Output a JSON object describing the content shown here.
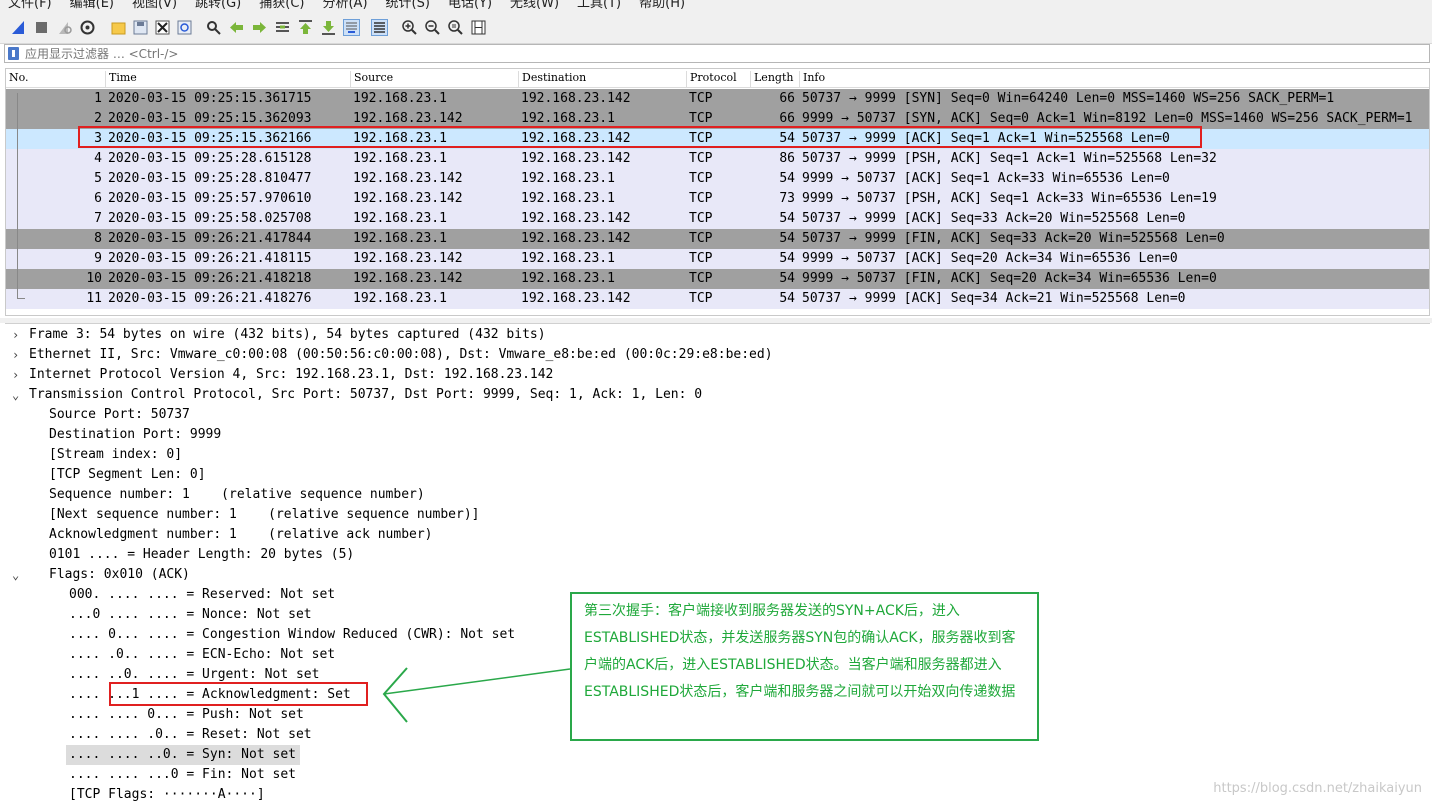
{
  "menu": {
    "items": [
      "文件(F)",
      "编辑(E)",
      "视图(V)",
      "跳转(G)",
      "捕获(C)",
      "分析(A)",
      "统计(S)",
      "电话(Y)",
      "无线(W)",
      "工具(T)",
      "帮助(H)"
    ]
  },
  "toolbar": {
    "icons": [
      "shark-fin-start-icon",
      "stop-icon",
      "restart-icon",
      "options-gear-icon",
      "open-folder-icon",
      "save-icon",
      "close-file-icon",
      "reload-icon",
      "find-icon",
      "back-arrow-icon",
      "forward-arrow-icon",
      "goto-packet-icon",
      "first-packet-icon",
      "last-packet-icon",
      "autoscroll-icon",
      "colorize-icon",
      "zoom-in-icon",
      "zoom-out-icon",
      "zoom-reset-icon",
      "resize-columns-icon"
    ]
  },
  "filter": {
    "placeholder": "应用显示过滤器 … <Ctrl-/>"
  },
  "columns": {
    "no": "No.",
    "time": "Time",
    "source": "Source",
    "destination": "Destination",
    "protocol": "Protocol",
    "length": "Length",
    "info": "Info"
  },
  "packets": [
    {
      "no": "1",
      "time": "2020-03-15 09:25:15.361715",
      "src": "192.168.23.1",
      "dst": "192.168.23.142",
      "proto": "TCP",
      "len": "66",
      "info": "50737 → 9999 [SYN] Seq=0 Win=64240 Len=0 MSS=1460 WS=256 SACK_PERM=1"
    },
    {
      "no": "2",
      "time": "2020-03-15 09:25:15.362093",
      "src": "192.168.23.142",
      "dst": "192.168.23.1",
      "proto": "TCP",
      "len": "66",
      "info": "9999 → 50737 [SYN, ACK] Seq=0 Ack=1 Win=8192 Len=0 MSS=1460 WS=256 SACK_PERM=1"
    },
    {
      "no": "3",
      "time": "2020-03-15 09:25:15.362166",
      "src": "192.168.23.1",
      "dst": "192.168.23.142",
      "proto": "TCP",
      "len": "54",
      "info": "50737 → 9999 [ACK] Seq=1 Ack=1 Win=525568 Len=0"
    },
    {
      "no": "4",
      "time": "2020-03-15 09:25:28.615128",
      "src": "192.168.23.1",
      "dst": "192.168.23.142",
      "proto": "TCP",
      "len": "86",
      "info": "50737 → 9999 [PSH, ACK] Seq=1 Ack=1 Win=525568 Len=32"
    },
    {
      "no": "5",
      "time": "2020-03-15 09:25:28.810477",
      "src": "192.168.23.142",
      "dst": "192.168.23.1",
      "proto": "TCP",
      "len": "54",
      "info": "9999 → 50737 [ACK] Seq=1 Ack=33 Win=65536 Len=0"
    },
    {
      "no": "6",
      "time": "2020-03-15 09:25:57.970610",
      "src": "192.168.23.142",
      "dst": "192.168.23.1",
      "proto": "TCP",
      "len": "73",
      "info": "9999 → 50737 [PSH, ACK] Seq=1 Ack=33 Win=65536 Len=19"
    },
    {
      "no": "7",
      "time": "2020-03-15 09:25:58.025708",
      "src": "192.168.23.1",
      "dst": "192.168.23.142",
      "proto": "TCP",
      "len": "54",
      "info": "50737 → 9999 [ACK] Seq=33 Ack=20 Win=525568 Len=0"
    },
    {
      "no": "8",
      "time": "2020-03-15 09:26:21.417844",
      "src": "192.168.23.1",
      "dst": "192.168.23.142",
      "proto": "TCP",
      "len": "54",
      "info": "50737 → 9999 [FIN, ACK] Seq=33 Ack=20 Win=525568 Len=0"
    },
    {
      "no": "9",
      "time": "2020-03-15 09:26:21.418115",
      "src": "192.168.23.142",
      "dst": "192.168.23.1",
      "proto": "TCP",
      "len": "54",
      "info": "9999 → 50737 [ACK] Seq=20 Ack=34 Win=65536 Len=0"
    },
    {
      "no": "10",
      "time": "2020-03-15 09:26:21.418218",
      "src": "192.168.23.142",
      "dst": "192.168.23.1",
      "proto": "TCP",
      "len": "54",
      "info": "9999 → 50737 [FIN, ACK] Seq=20 Ack=34 Win=65536 Len=0"
    },
    {
      "no": "11",
      "time": "2020-03-15 09:26:21.418276",
      "src": "192.168.23.1",
      "dst": "192.168.23.142",
      "proto": "TCP",
      "len": "54",
      "info": "50737 → 9999 [ACK] Seq=34 Ack=21 Win=525568 Len=0"
    }
  ],
  "details": [
    {
      "text": "Frame 3: 54 bytes on wire (432 bits), 54 bytes captured (432 bits)",
      "arrow": "›"
    },
    {
      "text": "Ethernet II, Src: Vmware_c0:00:08 (00:50:56:c0:00:08), Dst: Vmware_e8:be:ed (00:0c:29:e8:be:ed)",
      "arrow": "›"
    },
    {
      "text": "Internet Protocol Version 4, Src: 192.168.23.1, Dst: 192.168.23.142",
      "arrow": "›"
    },
    {
      "text": "Transmission Control Protocol, Src Port: 50737, Dst Port: 9999, Seq: 1, Ack: 1, Len: 0",
      "arrow": "⌄"
    },
    {
      "text": "Source Port: 50737"
    },
    {
      "text": "Destination Port: 9999"
    },
    {
      "text": "[Stream index: 0]"
    },
    {
      "text": "[TCP Segment Len: 0]"
    },
    {
      "text": "Sequence number: 1    (relative sequence number)"
    },
    {
      "text": "[Next sequence number: 1    (relative sequence number)]"
    },
    {
      "text": "Acknowledgment number: 1    (relative ack number)"
    },
    {
      "text": "0101 .... = Header Length: 20 bytes (5)"
    },
    {
      "text": "Flags: 0x010 (ACK)",
      "arrow": "⌄"
    },
    {
      "text": "000. .... .... = Reserved: Not set"
    },
    {
      "text": "...0 .... .... = Nonce: Not set"
    },
    {
      "text": ".... 0... .... = Congestion Window Reduced (CWR): Not set"
    },
    {
      "text": ".... .0.. .... = ECN-Echo: Not set"
    },
    {
      "text": ".... ..0. .... = Urgent: Not set"
    },
    {
      "text": ".... ...1 .... = Acknowledgment: Set"
    },
    {
      "text": ".... .... 0... = Push: Not set"
    },
    {
      "text": ".... .... .0.. = Reset: Not set"
    },
    {
      "text": ".... .... ..0. = Syn: Not set"
    },
    {
      "text": ".... .... ...0 = Fin: Not set"
    },
    {
      "text": "[TCP Flags: ·······A····]"
    }
  ],
  "annotation": {
    "note": "第三次握手：客户端接收到服务器发送的SYN+ACK后，进入ESTABLISHED状态，并发送服务器SYN包的确认ACK，服务器收到客户端的ACK后，进入ESTABLISHED状态。当客户端和服务器都进入ESTABLISHED状态后，客户端和服务器之间就可以开始双向传递数据"
  },
  "watermark": "https://blog.csdn.net/zhaikaiyun",
  "colors": {
    "selected_row": "#cce8ff",
    "gray_row": "#a0a0a0",
    "lavender_row": "#e8e8f8",
    "highlight_box": "#e02020",
    "note_green": "#1fa83a"
  }
}
